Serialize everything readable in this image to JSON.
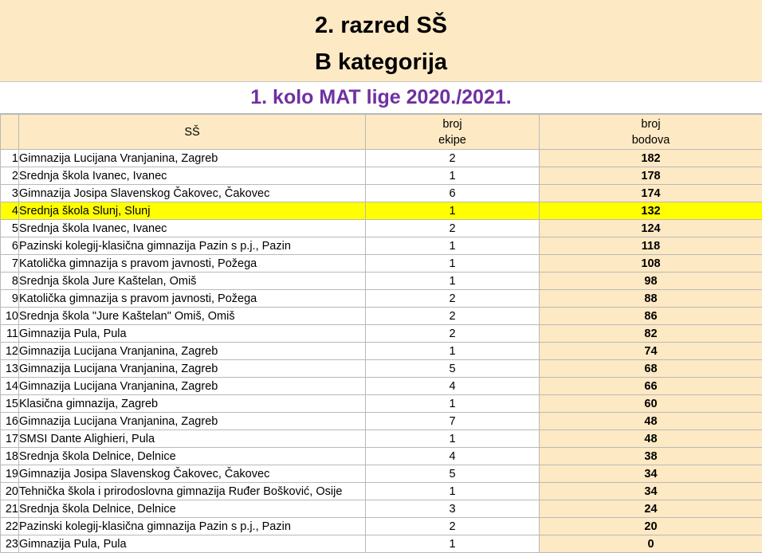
{
  "header": {
    "line1": "2. razred SŠ",
    "line2": "B kategorija",
    "subtitle": "1. kolo MAT lige 2020./2021."
  },
  "columns": {
    "school": "SŠ",
    "team_l1": "broj",
    "team_l2": "ekipe",
    "points_l1": "broj",
    "points_l2": "bodova"
  },
  "colors": {
    "band": "#fde9c4",
    "highlight": "#ffff00",
    "subtitle": "#7030a0"
  },
  "rows": [
    {
      "rank": "1",
      "school": "Gimnazija Lucijana Vranjanina, Zagreb",
      "team": "2",
      "points": "182"
    },
    {
      "rank": "2",
      "school": "Srednja škola Ivanec, Ivanec",
      "team": "1",
      "points": "178"
    },
    {
      "rank": "3",
      "school": "Gimnazija Josipa Slavenskog Čakovec, Čakovec",
      "team": "6",
      "points": "174"
    },
    {
      "rank": "4",
      "school": "Srednja škola Slunj, Slunj",
      "team": "1",
      "points": "132",
      "highlight": true
    },
    {
      "rank": "5",
      "school": "Srednja škola Ivanec, Ivanec",
      "team": "2",
      "points": "124"
    },
    {
      "rank": "6",
      "school": "Pazinski kolegij-klasična gimnazija Pazin s p.j., Pazin",
      "team": "1",
      "points": "118"
    },
    {
      "rank": "7",
      "school": "Katolička gimnazija s pravom javnosti, Požega",
      "team": "1",
      "points": "108"
    },
    {
      "rank": "8",
      "school": "Srednja škola Jure Kaštelan, Omiš",
      "team": "1",
      "points": "98"
    },
    {
      "rank": "9",
      "school": "Katolička gimnazija s pravom javnosti, Požega",
      "team": "2",
      "points": "88"
    },
    {
      "rank": "10",
      "school": "Srednja škola \"Jure Kaštelan\" Omiš, Omiš",
      "team": "2",
      "points": "86"
    },
    {
      "rank": "11",
      "school": "Gimnazija Pula, Pula",
      "team": "2",
      "points": "82"
    },
    {
      "rank": "12",
      "school": "Gimnazija Lucijana Vranjanina, Zagreb",
      "team": "1",
      "points": "74"
    },
    {
      "rank": "13",
      "school": "Gimnazija Lucijana Vranjanina, Zagreb",
      "team": "5",
      "points": "68"
    },
    {
      "rank": "14",
      "school": "Gimnazija Lucijana Vranjanina, Zagreb",
      "team": "4",
      "points": "66"
    },
    {
      "rank": "15",
      "school": "Klasična gimnazija, Zagreb",
      "team": "1",
      "points": "60"
    },
    {
      "rank": "16",
      "school": "Gimnazija Lucijana Vranjanina, Zagreb",
      "team": "7",
      "points": "48"
    },
    {
      "rank": "17",
      "school": "SMSI Dante Alighieri, Pula",
      "team": "1",
      "points": "48"
    },
    {
      "rank": "18",
      "school": "Srednja škola Delnice, Delnice",
      "team": "4",
      "points": "38"
    },
    {
      "rank": "19",
      "school": "Gimnazija Josipa Slavenskog Čakovec, Čakovec",
      "team": "5",
      "points": "34"
    },
    {
      "rank": "20",
      "school": "Tehnička škola i prirodoslovna gimnazija Ruđer Bošković, Osije",
      "team": "1",
      "points": "34"
    },
    {
      "rank": "21",
      "school": "Srednja škola Delnice, Delnice",
      "team": "3",
      "points": "24"
    },
    {
      "rank": "22",
      "school": "Pazinski kolegij-klasična gimnazija Pazin s p.j., Pazin",
      "team": "2",
      "points": "20"
    },
    {
      "rank": "23",
      "school": "Gimnazija Pula, Pula",
      "team": "1",
      "points": "0"
    }
  ]
}
